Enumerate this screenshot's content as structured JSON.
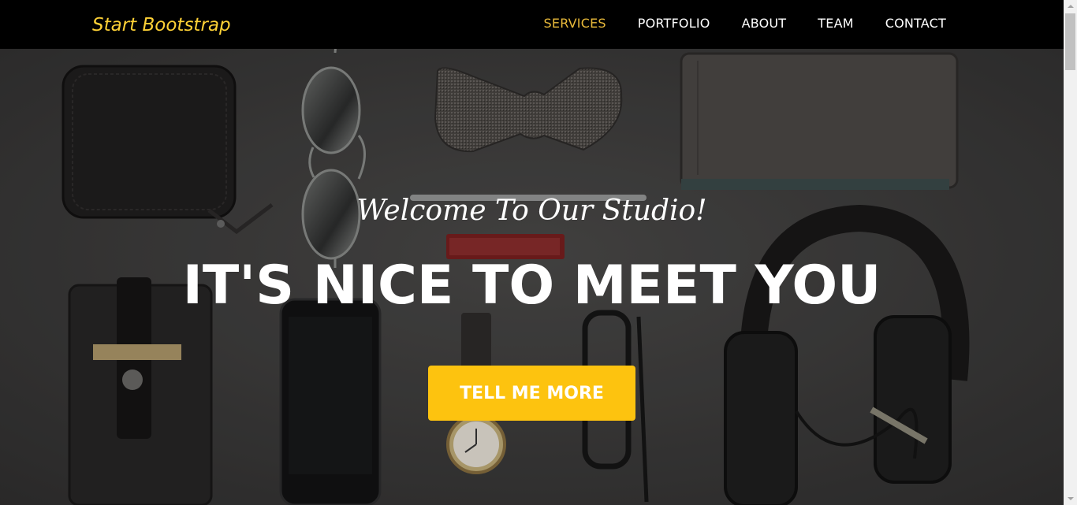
{
  "navbar": {
    "brand": "Start Bootstrap",
    "items": [
      {
        "label": "SERVICES",
        "active": true
      },
      {
        "label": "PORTFOLIO",
        "active": false
      },
      {
        "label": "ABOUT",
        "active": false
      },
      {
        "label": "TEAM",
        "active": false
      },
      {
        "label": "CONTACT",
        "active": false
      }
    ]
  },
  "hero": {
    "subheading": "Welcome To Our Studio!",
    "heading": "IT'S NICE TO MEET YOU",
    "cta_label": "TELL ME MORE"
  },
  "colors": {
    "accent": "#fed136",
    "nav_active": "#e8b93a",
    "navbar_bg": "#000000",
    "cta_bg": "#fdc30f",
    "hero_bg": "#3c3b3b"
  },
  "icons": {
    "scroll_up": "scroll-up-arrow",
    "scroll_down": "scroll-down-arrow"
  }
}
